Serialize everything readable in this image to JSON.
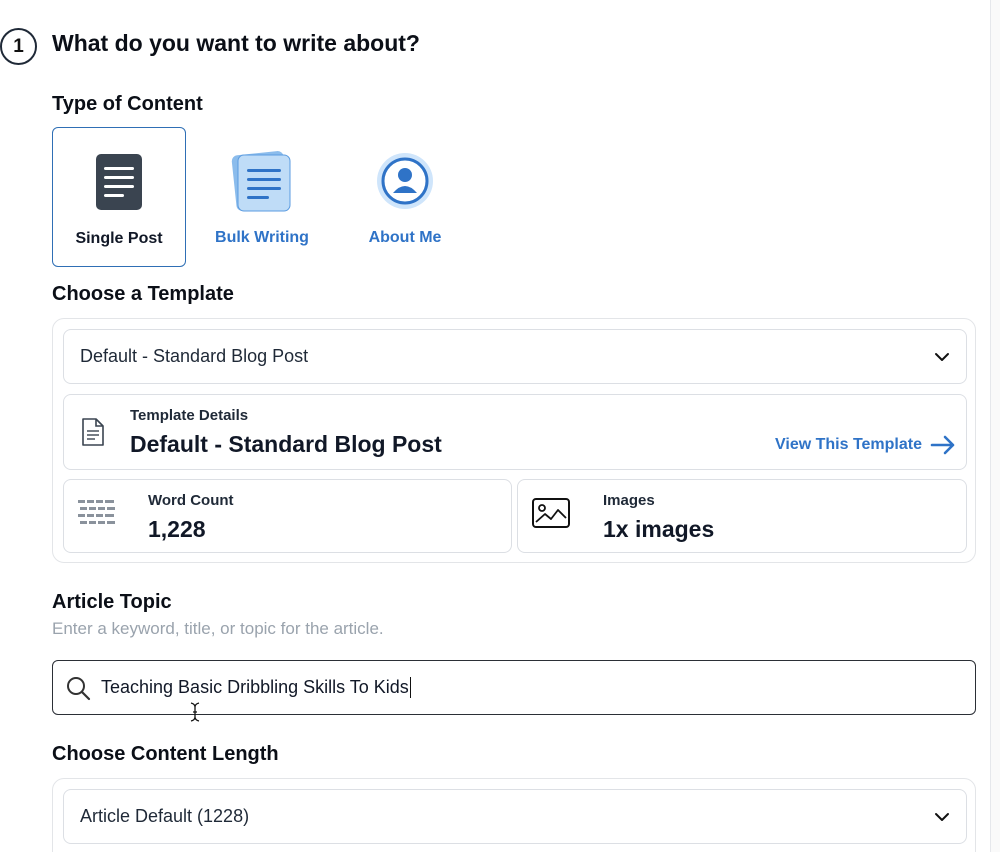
{
  "step": {
    "number": "1",
    "title": "What do you want to write about?"
  },
  "content_type": {
    "label": "Type of Content",
    "options": [
      {
        "label": "Single Post",
        "icon": "document-icon",
        "selected": true
      },
      {
        "label": "Bulk Writing",
        "icon": "documents-stack-icon",
        "selected": false
      },
      {
        "label": "About Me",
        "icon": "user-circle-icon",
        "selected": false
      }
    ]
  },
  "template": {
    "label": "Choose a Template",
    "selected": "Default - Standard Blog Post",
    "details_label": "Template Details",
    "details_value": "Default - Standard Blog Post",
    "view_link": "View This Template",
    "word_count_label": "Word Count",
    "word_count_value": "1,228",
    "images_label": "Images",
    "images_value": "1x images"
  },
  "topic": {
    "label": "Article Topic",
    "hint": "Enter a keyword, title, or topic for the article.",
    "value": "Teaching Basic Dribbling Skills To Kids"
  },
  "length": {
    "label": "Choose Content Length",
    "selected": "Article Default (1228)"
  },
  "colors": {
    "accent_blue": "#2f73c7",
    "dark_icon": "#3a4450",
    "light_blue_icon": "#bfdcf7"
  }
}
